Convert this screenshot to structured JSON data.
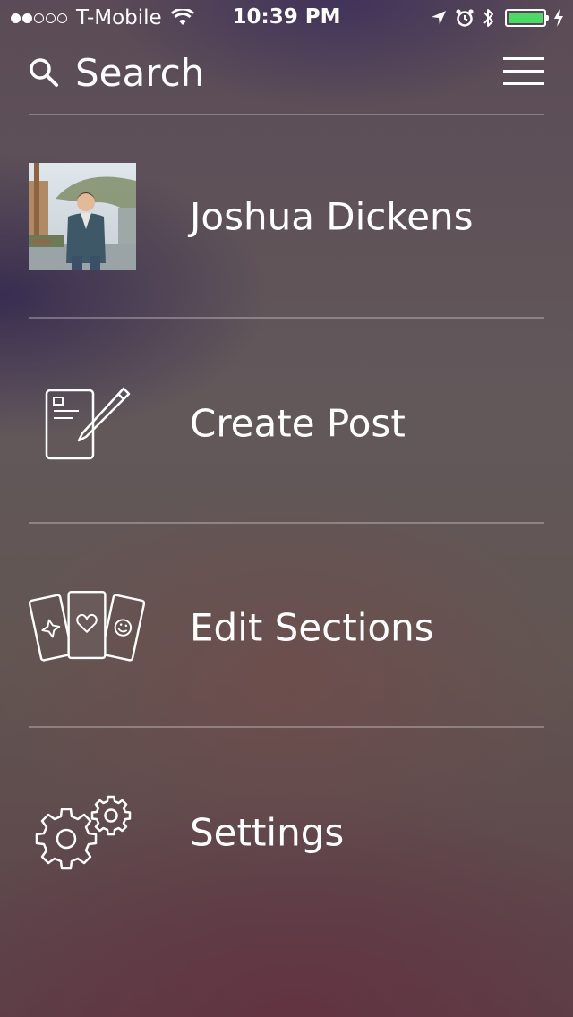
{
  "status_bar": {
    "signal_strength": 2,
    "signal_max": 5,
    "carrier": "T-Mobile",
    "time": "10:39 PM",
    "battery_color": "#4cd964"
  },
  "header": {
    "search_label": "Search",
    "search_icon": "search-icon",
    "menu_icon": "hamburger-menu-icon"
  },
  "menu": {
    "items": [
      {
        "label": "Joshua Dickens",
        "icon": "avatar"
      },
      {
        "label": "Create Post",
        "icon": "compose-icon"
      },
      {
        "label": "Edit Sections",
        "icon": "cards-icon"
      },
      {
        "label": "Settings",
        "icon": "gears-icon"
      }
    ]
  }
}
